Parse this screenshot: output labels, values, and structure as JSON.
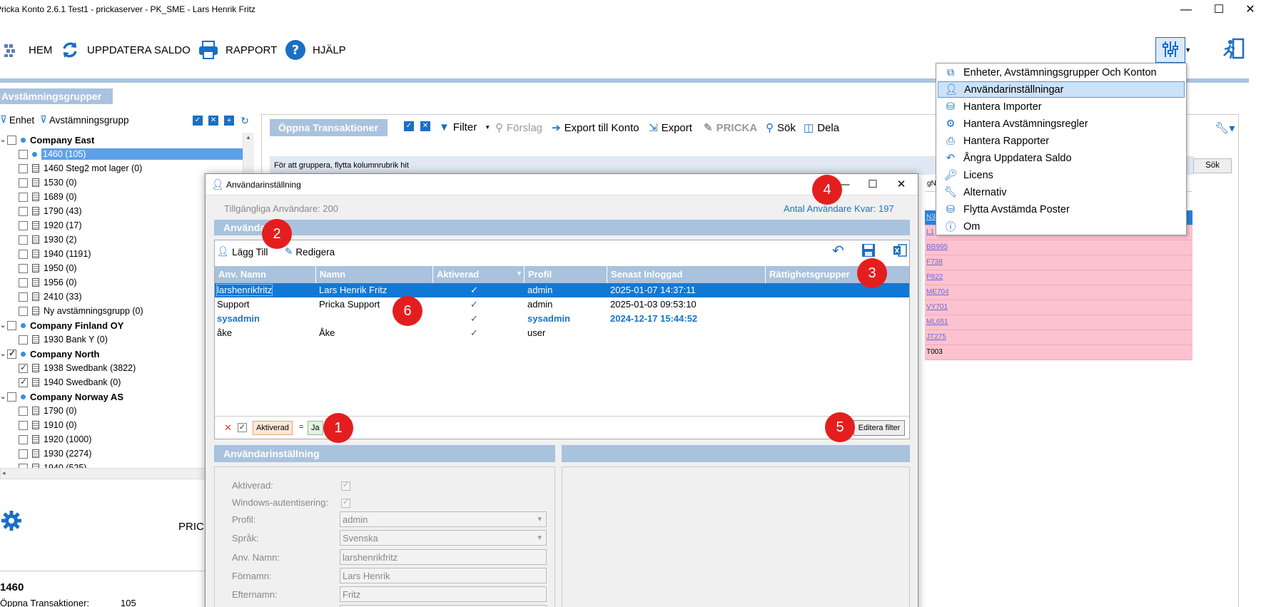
{
  "window": {
    "title": "Pricka Konto 2.6.1 Test1 - prickaserver - PK_SME - Lars Henrik Fritz",
    "controls": {
      "minimize": "—",
      "maximize": "☐",
      "close": "✕"
    }
  },
  "toolbar": {
    "home": "HEM",
    "refresh": "UPPDATERA SALDO",
    "report": "RAPPORT",
    "help": "HJÄLP"
  },
  "left": {
    "header": "Avstämningsgrupper",
    "filter_unit": "Enhet",
    "filter_group": "Avstämningsgrupp",
    "tree": [
      {
        "label": "Company East",
        "type": "company"
      },
      {
        "label": "1460 (105)",
        "type": "selected"
      },
      {
        "label": "1460 Steg2 mot lager (0)",
        "type": "item"
      },
      {
        "label": "1530 (0)",
        "type": "item"
      },
      {
        "label": "1689 (0)",
        "type": "item"
      },
      {
        "label": "1790 (43)",
        "type": "item"
      },
      {
        "label": "1920 (17)",
        "type": "item"
      },
      {
        "label": "1930 (2)",
        "type": "item"
      },
      {
        "label": "1940 (1191)",
        "type": "item"
      },
      {
        "label": "1950 (0)",
        "type": "item"
      },
      {
        "label": "1956 (0)",
        "type": "item"
      },
      {
        "label": "2410 (33)",
        "type": "item"
      },
      {
        "label": "Ny avstämningsgrupp (0)",
        "type": "item"
      },
      {
        "label": "Company Finland OY",
        "type": "company"
      },
      {
        "label": "1930 Bank Y (0)",
        "type": "item"
      },
      {
        "label": "Company North",
        "type": "company-checked"
      },
      {
        "label": "1938 Swedbank (3822)",
        "type": "item-checked"
      },
      {
        "label": "1940 Swedbank (0)",
        "type": "item-checked"
      },
      {
        "label": "Company Norway AS",
        "type": "company"
      },
      {
        "label": "1790 (0)",
        "type": "item"
      },
      {
        "label": "1910 (0)",
        "type": "item"
      },
      {
        "label": "1920 (1000)",
        "type": "item"
      },
      {
        "label": "1930 (2274)",
        "type": "item"
      },
      {
        "label": "1940 (525)",
        "type": "item"
      }
    ],
    "bottom_label": "PRIC",
    "account": "1460",
    "open_tx_label": "Öppna Transaktioner:",
    "open_tx_value": "105"
  },
  "center": {
    "header": "Öppna Transaktioner",
    "filter": "Filter",
    "suggestion": "Förslag",
    "export_account": "Export till Konto",
    "export": "Export",
    "pricka": "PRICKA",
    "search": "Sök",
    "share": "Dela",
    "group_hint": "För att gruppera, flytta kolumnrubrik hit",
    "search_button": "Sök",
    "col_fragment": "gN",
    "pink_rows": [
      "N3",
      "L1",
      "BB995",
      "F738",
      "P822",
      "ME704",
      "VY701",
      "ML651",
      "JT275",
      "T003"
    ]
  },
  "menu": {
    "items": [
      {
        "label": "Enheter, Avstämningsgrupper Och Konton",
        "icon": "units-icon"
      },
      {
        "label": "Användarinställningar",
        "icon": "user-icon"
      },
      {
        "label": "Hantera Importer",
        "icon": "database-icon"
      },
      {
        "label": "Hantera Avstämningsregler",
        "icon": "gear-icon"
      },
      {
        "label": "Hantera Rapporter",
        "icon": "printer-icon"
      },
      {
        "label": "Ångra Uppdatera Saldo",
        "icon": "undo-icon"
      },
      {
        "label": "Licens",
        "icon": "key-icon"
      },
      {
        "label": "Alternativ",
        "icon": "wrench-icon"
      },
      {
        "label": "Flytta Avstämda Poster",
        "icon": "move-icon"
      },
      {
        "label": "Om",
        "icon": "info-icon"
      }
    ],
    "highlighted_index": 1
  },
  "dialog": {
    "title": "Användarinställning",
    "available_users": "Tillgängliga Användare: 200",
    "remaining_users": "Antal Användare Kvar: 197",
    "users_header": "Användare",
    "add": "Lägg Till",
    "edit": "Redigera",
    "columns": [
      "Anv. Namn",
      "Namn",
      "Aktiverad",
      "Profil",
      "Senast Inloggad",
      "Rättighetsgrupper"
    ],
    "rows": [
      {
        "user": "larshenrikfritz",
        "name": "Lars Henrik Fritz",
        "active": "✓",
        "profile": "admin",
        "last_login": "2025-01-07 14:37:11",
        "style": "selected"
      },
      {
        "user": "Support",
        "name": "Pricka Support",
        "active": "✓",
        "profile": "admin",
        "last_login": "2025-01-03 09:53:10",
        "style": "normal"
      },
      {
        "user": "sysadmin",
        "name": "",
        "active": "✓",
        "profile": "sysadmin",
        "last_login": "2024-12-17 15:44:52",
        "style": "bold-blue"
      },
      {
        "user": "åke",
        "name": "Åke",
        "active": "✓",
        "profile": "user",
        "last_login": "",
        "style": "normal"
      }
    ],
    "filter_field": "Aktiverad",
    "filter_op": "=",
    "filter_value": "Ja",
    "edit_filter": "Editera filter",
    "settings_header": "Användarinställning",
    "fields": {
      "active": "Aktiverad:",
      "windows_auth": "Windows-autentisering:",
      "profile": "Profil:",
      "profile_value": "admin",
      "language": "Språk:",
      "language_value": "Svenska",
      "username": "Anv. Namn:",
      "username_value": "larshenrikfritz",
      "first_name": "Förnamn:",
      "first_name_value": "Lars Henrik",
      "last_name": "Efternamn:",
      "last_name_value": "Fritz"
    }
  },
  "annotations": [
    "1",
    "2",
    "3",
    "4",
    "5",
    "6"
  ],
  "colors": {
    "section_header": "#a9c2de",
    "selection": "#1278d6",
    "highlight_blue": "#1a73c9",
    "annotation_red": "#e41e1e",
    "pink_row": "#fcc2cf"
  }
}
